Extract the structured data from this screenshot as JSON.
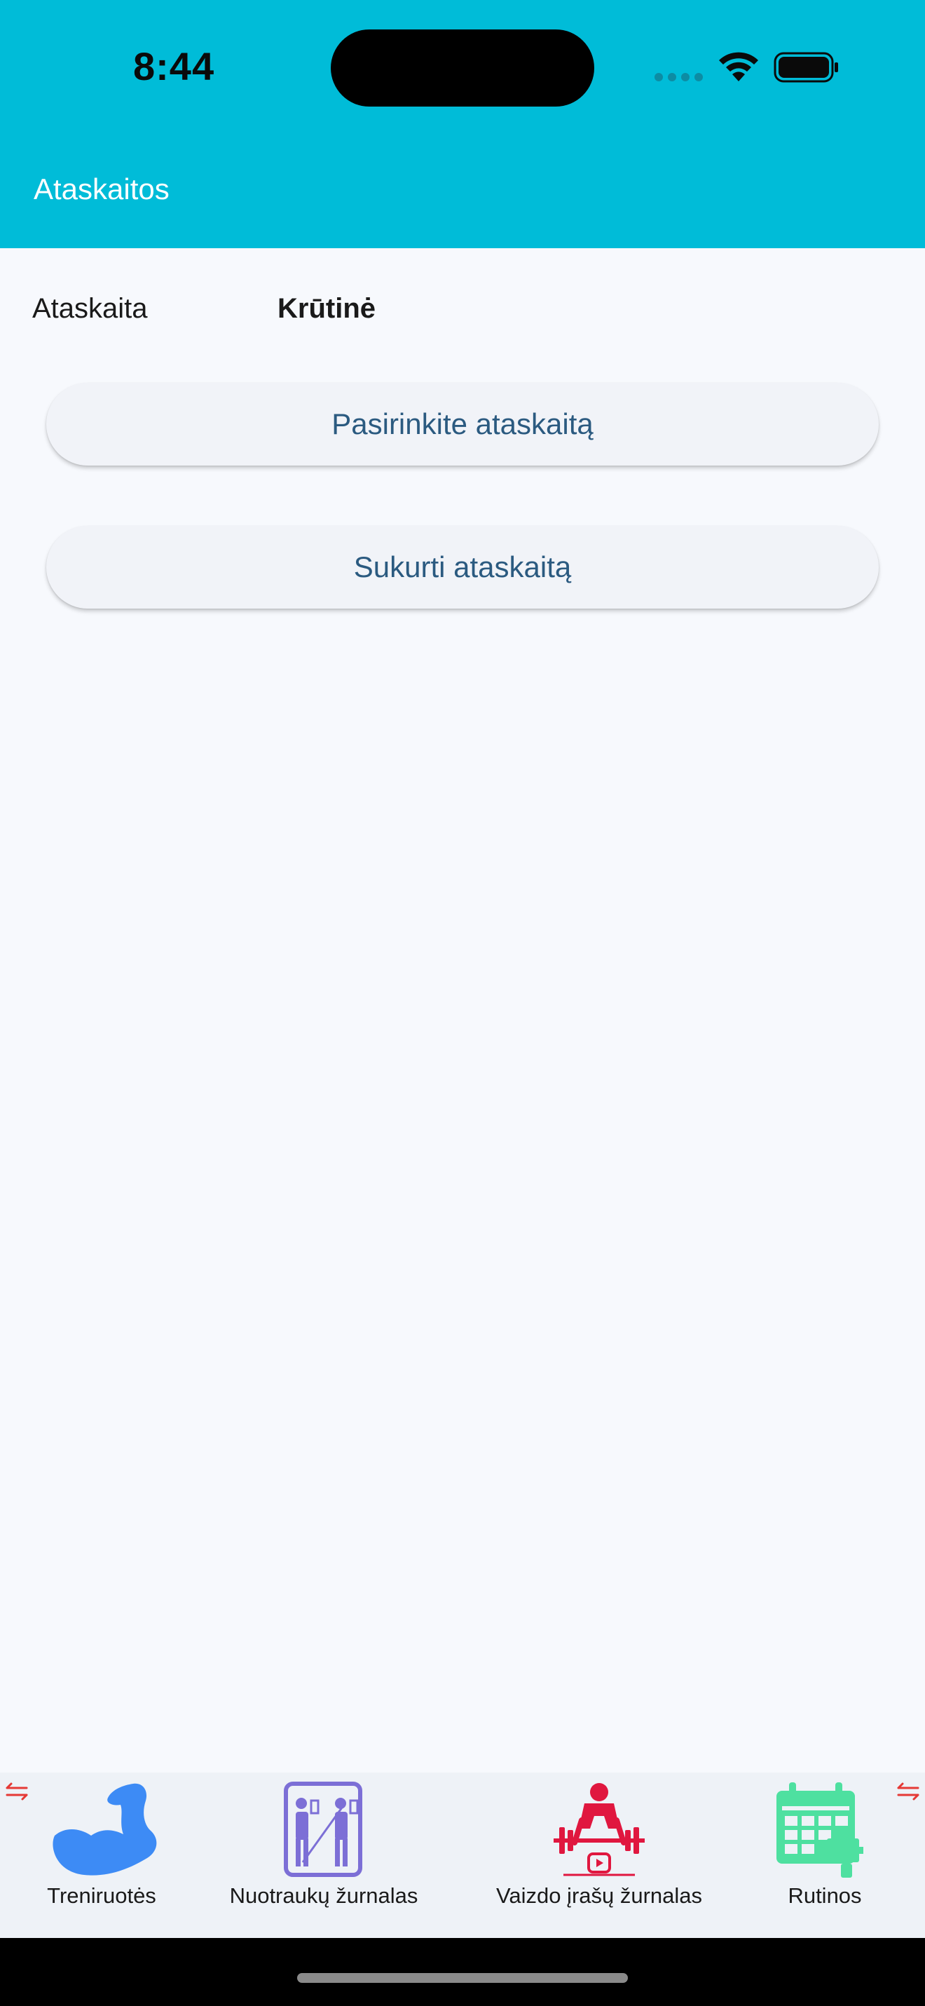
{
  "status_bar": {
    "time": "8:44"
  },
  "app_bar": {
    "title": "Ataskaitos"
  },
  "report": {
    "label": "Ataskaita",
    "value": "Krūtinė"
  },
  "buttons": {
    "select_label": "Pasirinkite ataskaitą",
    "create_label": "Sukurti ataskaitą"
  },
  "bottom_nav": {
    "items": [
      {
        "label": "Treniruotės",
        "icon": "flexed-arm-icon",
        "color": "#3d8bf5"
      },
      {
        "label": "Nuotraukų žurnalas",
        "icon": "mirror-photo-icon",
        "color": "#7c6fd6"
      },
      {
        "label": "Vaizdo įrašų žurnalas",
        "icon": "weightlifter-video-icon",
        "color": "#e0173f"
      },
      {
        "label": "Rutinos",
        "icon": "calendar-dumbbell-icon",
        "color": "#4ee0a0"
      }
    ],
    "scroll_indicator_color": "#e53935"
  },
  "colors": {
    "app_bar": "#00bcd8",
    "background": "#f7f9fd",
    "button_text": "#2b5a80"
  }
}
